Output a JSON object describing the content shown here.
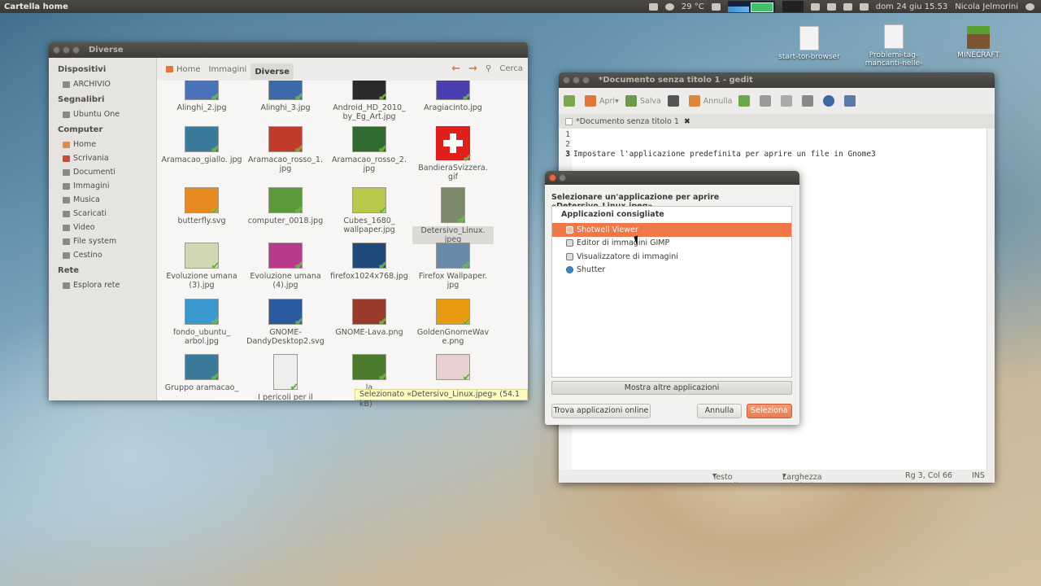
{
  "panel": {
    "app_title": "Cartella home",
    "temperature": "29 °C",
    "datetime": "dom 24 giu 15.53",
    "user": "Nicola Jelmorini"
  },
  "desktop_icons": [
    {
      "label": "start-tor-browser"
    },
    {
      "label": "Problemi-tag-mancanti-nelle-"
    },
    {
      "label": "MINECRAFT"
    }
  ],
  "file_manager": {
    "title": "Diverse",
    "breadcrumbs": [
      "Home",
      "Immagini",
      "Diverse"
    ],
    "search_label": "Cerca",
    "sidebar": {
      "sections": [
        {
          "heading": "Dispositivi",
          "items": [
            "ARCHIVIO"
          ]
        },
        {
          "heading": "Segnalibri",
          "items": [
            "Ubuntu One"
          ]
        },
        {
          "heading": "Computer",
          "items": [
            "Home",
            "Scrivania",
            "Documenti",
            "Immagini",
            "Musica",
            "Scaricati",
            "Video",
            "File system",
            "Cestino"
          ]
        },
        {
          "heading": "Rete",
          "items": [
            "Esplora rete"
          ]
        }
      ]
    },
    "files": [
      {
        "name": "Alinghi_2.jpg",
        "color": "#4a72b8"
      },
      {
        "name": "Alinghi_3.jpg",
        "color": "#3c6aa8"
      },
      {
        "name": "Android_HD_2010_ by_Eg_Art.jpg",
        "color": "#2a2a2a"
      },
      {
        "name": "Aragiacinto.jpg",
        "color": "#4a3fb0"
      },
      {
        "name": "Aramacao_giallo. jpg",
        "color": "#3b7a9a"
      },
      {
        "name": "Aramacao_rosso_1. jpg",
        "color": "#c23a2a"
      },
      {
        "name": "Aramacao_rosso_2. jpg",
        "color": "#2f6b2f"
      },
      {
        "name": "BandieraSvizzera. gif",
        "color": "#e0201d"
      },
      {
        "name": "butterfly.svg",
        "color": "#e8891f"
      },
      {
        "name": "computer_0018.jpg",
        "color": "#5a9a3a"
      },
      {
        "name": "Cubes_1680_ wallpaper.jpg",
        "color": "#b8c84a"
      },
      {
        "name": "Detersivo_Linux. jpeg",
        "color": "#7a8a6a"
      },
      {
        "name": "Evoluzione umana (3).jpg",
        "color": "#cfd8b0"
      },
      {
        "name": "Evoluzione umana (4).jpg",
        "color": "#b83a8a"
      },
      {
        "name": "firefox1024x768.jpg",
        "color": "#1e4a7a"
      },
      {
        "name": "Firefox Wallpaper. jpg",
        "color": "#6a8aaa"
      },
      {
        "name": "fondo_ubuntu_ arbol.jpg",
        "color": "#3a9ad0"
      },
      {
        "name": "GNOME- DandyDesktop2.svg",
        "color": "#2a5aa0"
      },
      {
        "name": "GNOME-Lava.png",
        "color": "#9a3a2a"
      },
      {
        "name": "GoldenGnomeWav e.png",
        "color": "#e89a10"
      },
      {
        "name": "Gruppo aramacao_",
        "color": "#3b7a9a"
      },
      {
        "name": "I pericoli per il",
        "color": "#eeeeee"
      },
      {
        "name": "la",
        "color": "#4a7a2a"
      },
      {
        "name": "",
        "color": "#e8d0d0"
      }
    ],
    "status_tip": "Selezionato «Detersivo_Linux.jpeg» (54.1 kB)"
  },
  "gedit": {
    "title": "*Documento senza titolo 1 - gedit",
    "toolbar": {
      "open": "Apri",
      "save": "Salva",
      "undo": "Annulla"
    },
    "tab_label": "*Documento senza titolo 1",
    "lines": [
      "1",
      "2",
      "3"
    ],
    "text_line3": "Impostare l'applicazione predefinita per aprire un file in Gnome3",
    "status": {
      "mode": "Testo semplice",
      "tab_width": "Larghezza tabulazione: 8",
      "position": "Rg 3, Col 66",
      "ins": "INS"
    }
  },
  "dialog": {
    "heading": "Selezionare un'applicazione per aprire «Detersivo_Linux.jpeg»",
    "list_heading": "Applicazioni consigliate",
    "apps": [
      "Shotwell Viewer",
      "Editor di immagini GIMP",
      "Visualizzatore di immagini",
      "Shutter"
    ],
    "selected_app": "Shotwell Viewer",
    "more_button": "Mostra altre applicazioni",
    "find_online": "Trova applicazioni online",
    "cancel": "Annulla",
    "select": "Seleziona"
  }
}
